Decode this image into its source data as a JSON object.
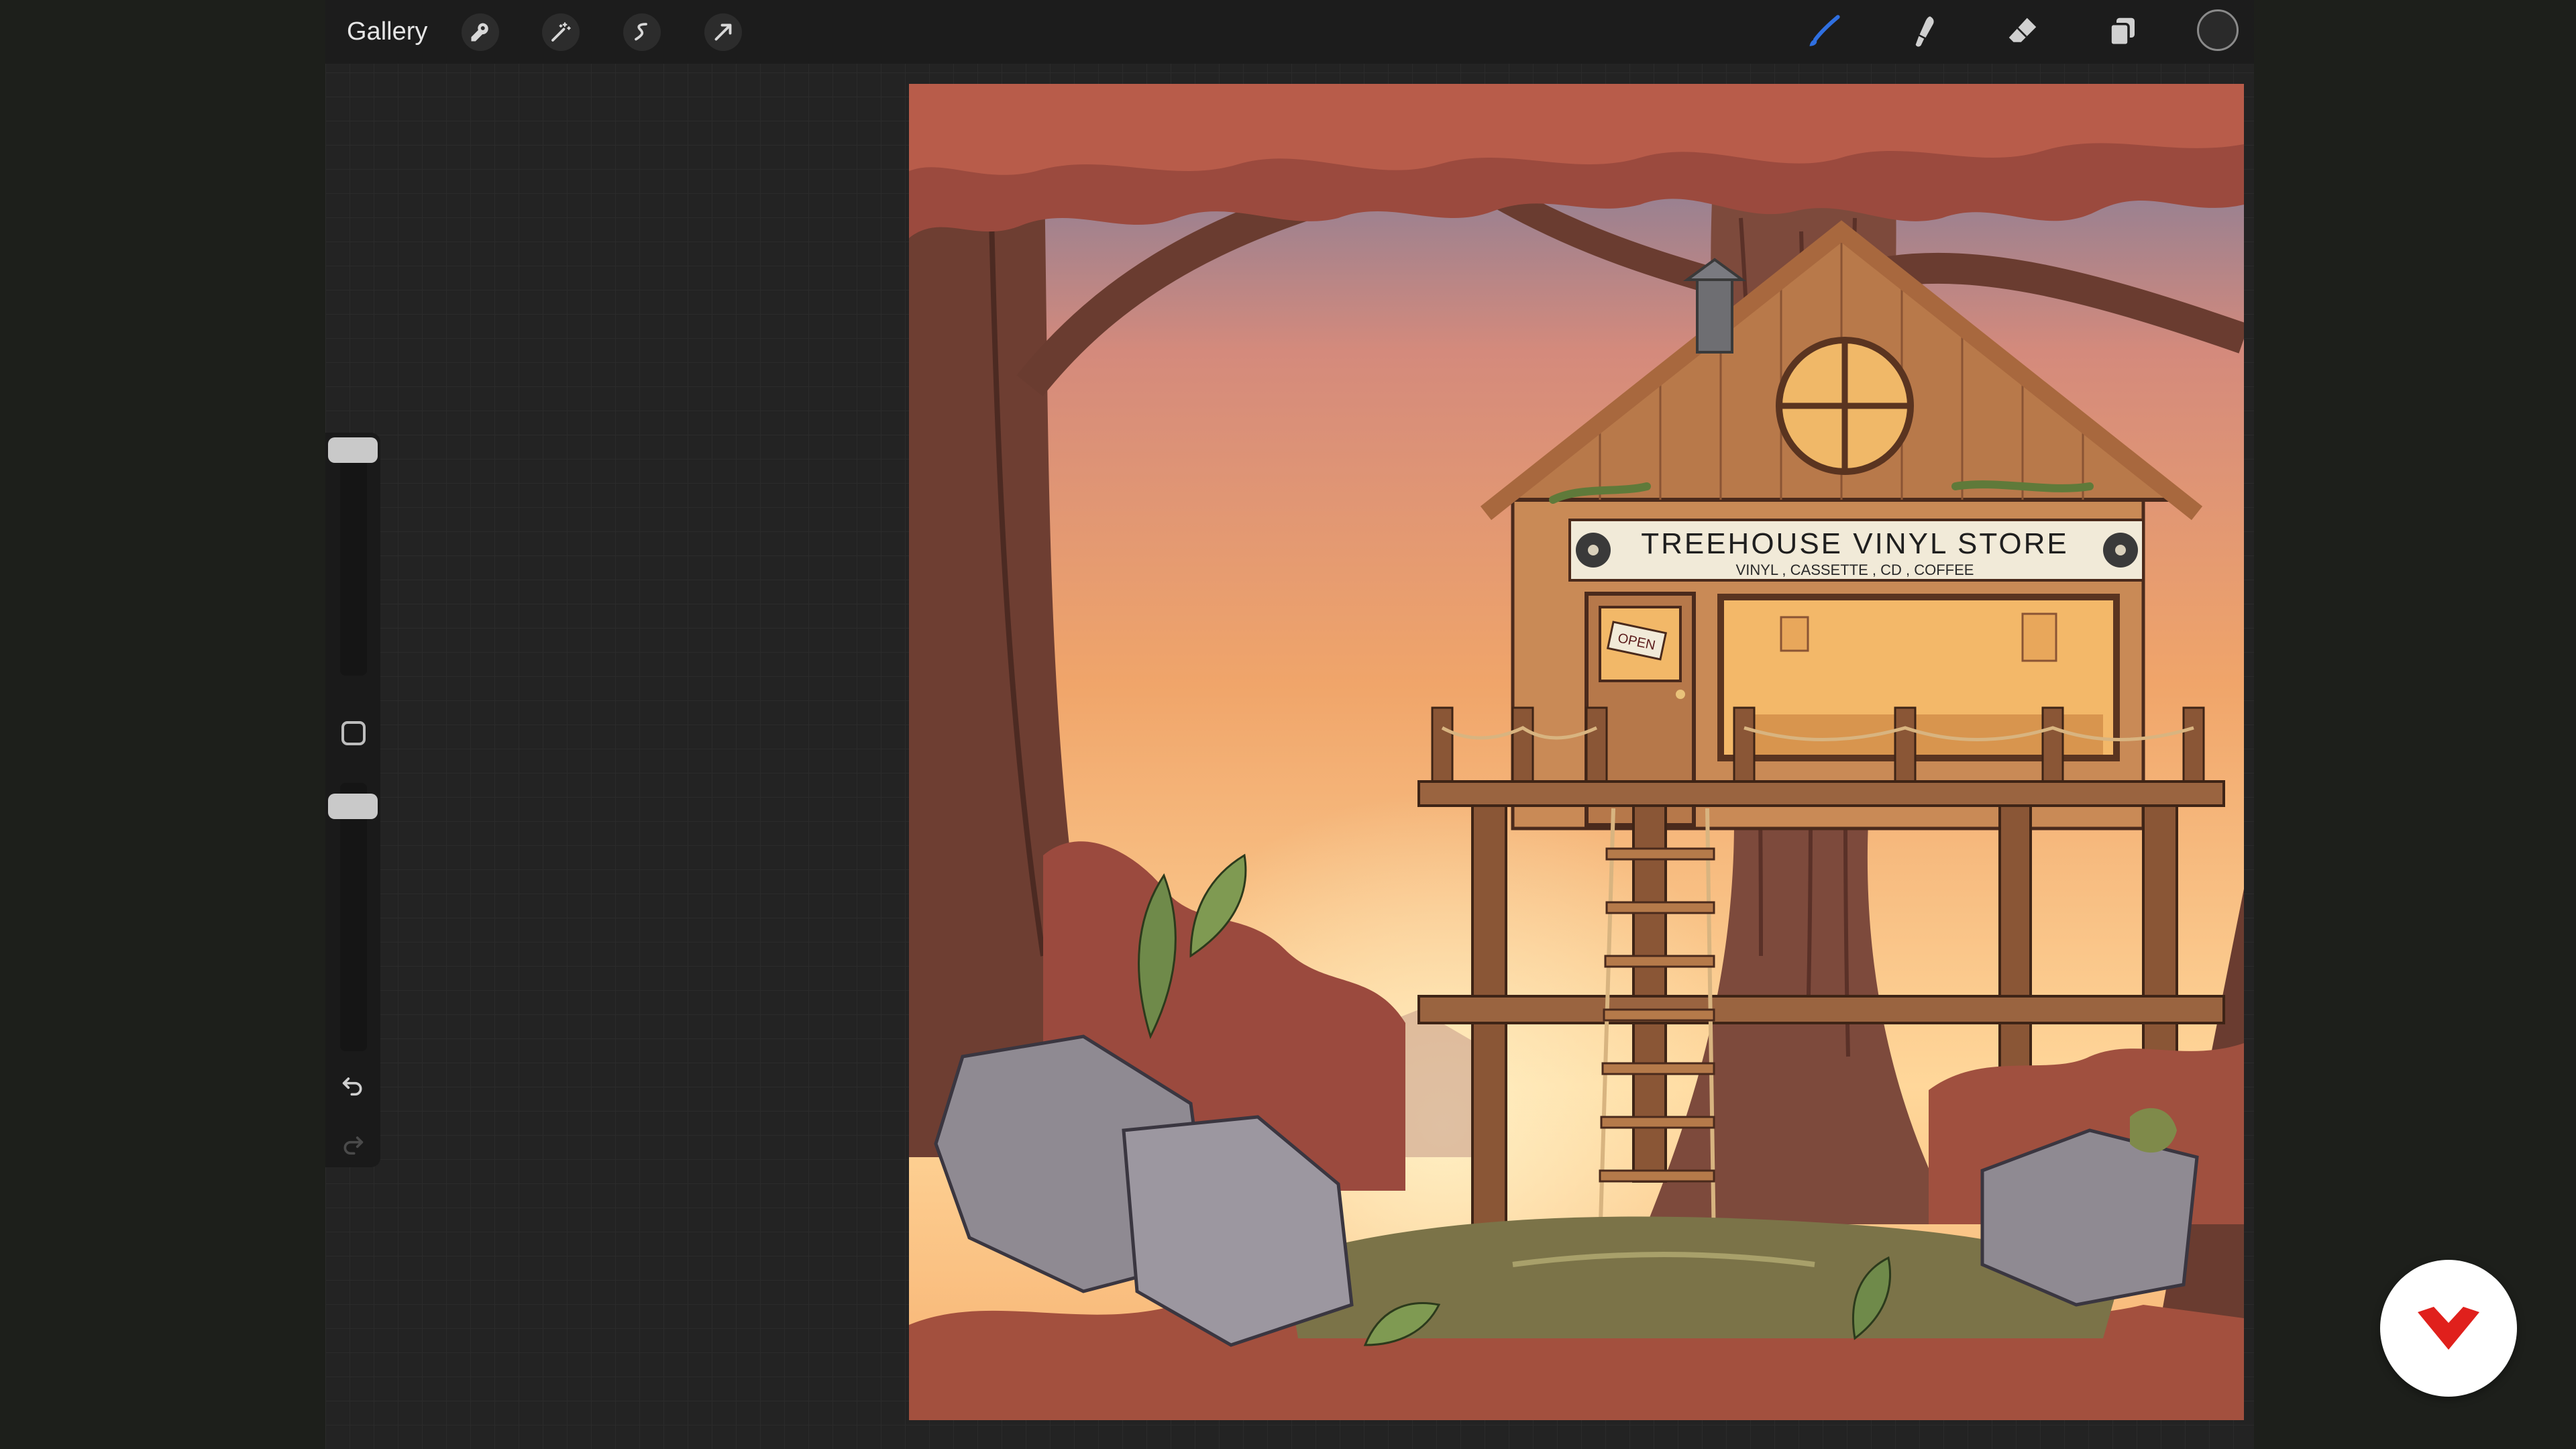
{
  "toolbar": {
    "gallery_label": "Gallery",
    "left_icons": [
      "wrench-icon",
      "magic-wand-icon",
      "selection-icon",
      "transform-arrow-icon"
    ],
    "right_icons": [
      "brush-icon",
      "smudge-icon",
      "eraser-icon",
      "layers-icon"
    ],
    "brush_active_color": "#2f6fe0",
    "current_color": "#2a2a2a"
  },
  "sidebar": {
    "brush_size_label": "Brush size",
    "opacity_label": "Opacity"
  },
  "artwork": {
    "sign_title": "TREEHOUSE VINYL STORE",
    "sign_subtitle": "VINYL , CASSETTE , CD , COFFEE",
    "door_sign": "OPEN"
  },
  "colors": {
    "sky_top": "#6f7aa0",
    "sky_mid": "#f0a56a",
    "sky_bottom": "#ffd79a",
    "foliage": "#9b4a3e",
    "bark": "#6a3c30",
    "wood": "#c98a56"
  }
}
